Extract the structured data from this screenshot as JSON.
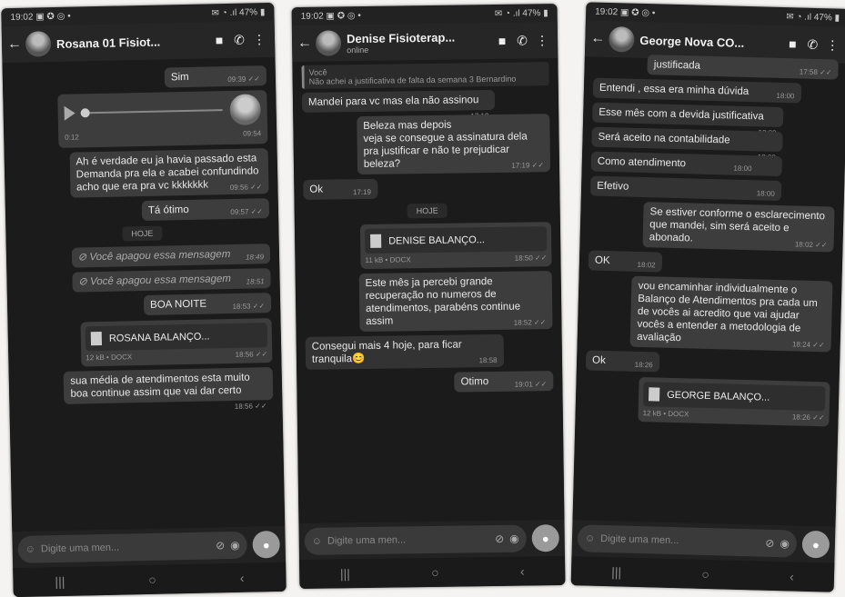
{
  "phones": [
    {
      "status": {
        "time": "19:02",
        "icons": "▣ ✪ ◎ •",
        "right": "✉ ◔ .ıl 47% ▮"
      },
      "header": {
        "name": "Rosana 01 Fisiot...",
        "sub": ""
      },
      "messages": {
        "m1": {
          "text": "Sim",
          "time": "09:39 ✓✓"
        },
        "audio": {
          "dur": "0:12",
          "time": "09:54"
        },
        "m2": {
          "text": "Ah é verdade eu ja havia passado esta Demanda pra ela e acabei confundindo acho que era pra vc kkkkkkk",
          "time": "09:56 ✓✓"
        },
        "m3": {
          "text": "Tá ótimo",
          "time": "09:57 ✓✓"
        },
        "date": "HOJE",
        "d1": {
          "text": "⊘ Você apagou essa mensagem",
          "time": "18:49"
        },
        "d2": {
          "text": "⊘ Você apagou essa mensagem",
          "time": "18:51"
        },
        "m4": {
          "text": "BOA NOITE",
          "time": "18:53 ✓✓"
        },
        "doc": {
          "name": "ROSANA BALANÇO...",
          "meta": "12 kB • DOCX",
          "time": "18:56 ✓✓"
        },
        "m5": {
          "text": "sua média de atendimentos esta muito boa continue assim que vai dar certo",
          "time": "18:56 ✓✓"
        }
      },
      "input_placeholder": "Digite uma men..."
    },
    {
      "status": {
        "time": "19:02",
        "icons": "▣ ✪ ◎ •",
        "right": "✉ ◔ .ıl 47% ▮"
      },
      "header": {
        "name": "Denise Fisioterap...",
        "sub": "online"
      },
      "messages": {
        "q": {
          "who": "Você",
          "text": "Não achei a justificativa de falta da semana 3 Bernardino"
        },
        "m1": {
          "text": "Mandei para vc mas ela não assinou",
          "time": "17:19"
        },
        "m2": {
          "text": "Beleza mas depois veja se consegue a assinatura dela pra justificar e não te prejudicar beleza?",
          "time": "17:19 ✓✓"
        },
        "m3": {
          "text": "Ok",
          "time": "17:19"
        },
        "date": "HOJE",
        "doc": {
          "name": "DENISE BALANÇO...",
          "meta": "11 kB • DOCX",
          "time": "18:50 ✓✓"
        },
        "m4": {
          "text": "Este mês ja percebi grande recuperação no numeros de atendimentos, parabéns continue assim",
          "time": "18:52 ✓✓"
        },
        "m5": {
          "text": "Consegui mais 4 hoje, para ficar tranquila😊",
          "time": "18:58"
        },
        "m6": {
          "text": "Otimo",
          "time": "19:01 ✓✓"
        }
      },
      "input_placeholder": "Digite uma men..."
    },
    {
      "status": {
        "time": "19:02",
        "icons": "▣ ✪ ◎ •",
        "right": "✉ ◔ .ıl 47% ▮"
      },
      "header": {
        "name": "George Nova CO...",
        "sub": ""
      },
      "messages": {
        "m0": {
          "text": "justificada",
          "time": "17:58 ✓✓"
        },
        "m1": {
          "text": "Entendi , essa era minha dúvida",
          "time": "18:00"
        },
        "m2": {
          "text": "Esse mês com a devida justificativa",
          "time": "18:00"
        },
        "m3": {
          "text": "Será aceito na contabilidade",
          "time": "18:00"
        },
        "m4": {
          "text": "Como atendimento",
          "time": "18:00"
        },
        "m5": {
          "text": "Efetivo",
          "time": "18:00"
        },
        "m6": {
          "text": "Se estiver conforme o esclarecimento que mandei, sim será aceito e abonado.",
          "time": "18:02 ✓✓"
        },
        "m7": {
          "text": "OK",
          "time": "18:02"
        },
        "m8": {
          "text": "vou encaminhar individualmente o Balanço de Atendimentos pra cada um de vocês ai acredito que vai ajudar vocês a entender a metodologia de avaliação",
          "time": "18:24 ✓✓"
        },
        "m9": {
          "text": "Ok",
          "time": "18:26"
        },
        "doc": {
          "name": "GEORGE BALANÇO...",
          "meta": "12 kB • DOCX",
          "time": "18:26 ✓✓"
        }
      },
      "input_placeholder": "Digite uma men..."
    }
  ]
}
